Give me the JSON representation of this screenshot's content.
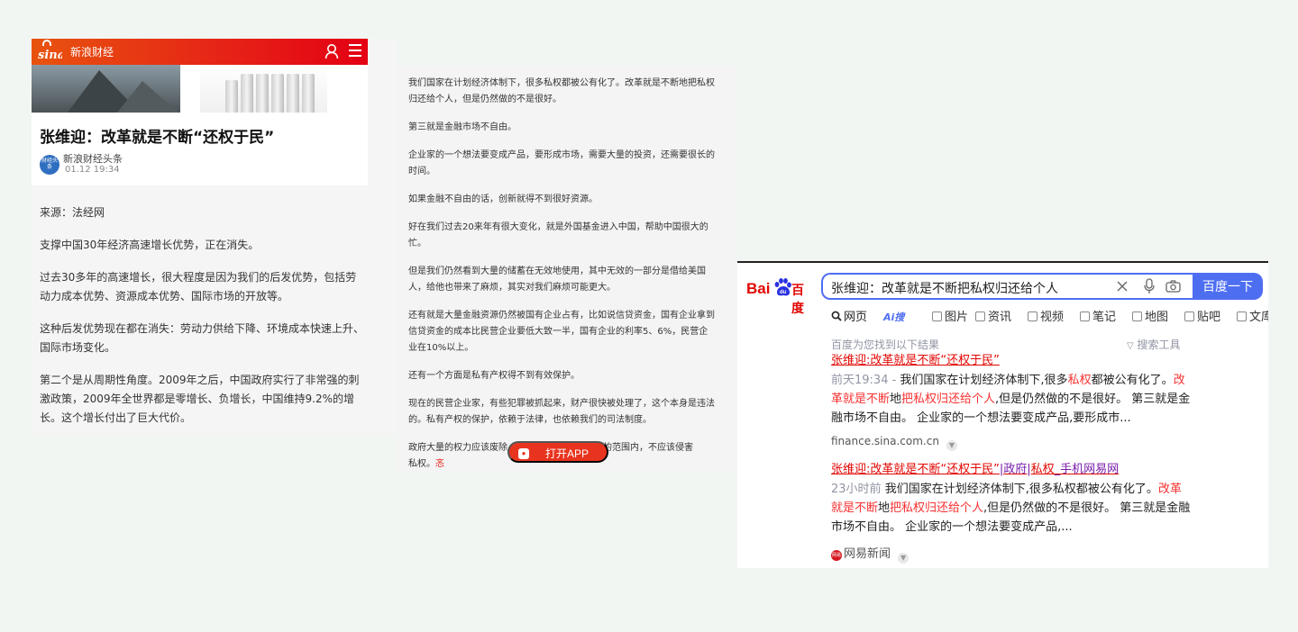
{
  "sina": {
    "channel": "新浪财经",
    "title": "张维迎：改革就是不断“还权于民”",
    "author": "新浪财经头条",
    "date": "01.12 19:34",
    "avatar_text": "财经头条",
    "paragraphs": [
      "来源：法经网",
      "支撑中国30年经济高速增长优势，正在消失。",
      "过去30多年的高速增长，很大程度是因为我们的后发优势，包括劳动力成本优势、资源成本优势、国际市场的开放等。",
      "这种后发优势现在都在消失：劳动力供给下降、环境成本快速上升、国际市场变化。",
      "第二个是从周期性角度。2009年之后，中国政府实行了非常强的刺激政策，2009年全世界都是零增长、负增长，中国维持9.2%的增长。这个增长付出了巨大代价。"
    ]
  },
  "continuation": {
    "paragraphs": [
      "我们国家在计划经济体制下，很多私权都被公有化了。改革就是不断地把私权归还给个人，但是仍然做的不是很好。",
      "第三就是金融市场不自由。",
      "企业家的一个想法要变成产品，要形成市场，需要大量的投资，还需要很长的时间。",
      "如果金融不自由的话，创新就得不到很好资源。",
      "好在我们过去20来年有很大变化，就是外国基金进入中国，帮助中国很大的忙。",
      "但是我们仍然看到大量的储蓄在无效地使用，其中无效的一部分是借给美国人，给他也带来了麻烦，其实对我们麻烦可能更大。",
      "还有就是大量金融资源仍然被国有企业占有，比如说信贷资金，国有企业拿到信贷资金的成本比民营企业要低大致一半，国有企业的利率5、6%，民营企业在10%以上。",
      "还有一个方面是私有产权得不到有效保护。",
      "现在的民营企业家，有些犯罪被抓起来，财产很快被处理了，这个本身是违法的。私有产权的保护，依赖于法律，也依赖我们的司法制度。"
    ],
    "last_paragraph_start": "政府大量的权力应该废除",
    "last_paragraph_end": "权的范围内，不应该侵害",
    "last_paragraph_tail": "私权。",
    "last_paragraph_red": "忞",
    "open_app_label": "打开APP"
  },
  "baidu": {
    "logo_latin": "Bai",
    "logo_cn": "百度",
    "query": "张维迎：改革就是不断把私权归还给个人",
    "submit_label": "百度一下",
    "tabs": [
      "网页",
      "Ai搜",
      "图片",
      "资讯",
      "视频",
      "笔记",
      "地图",
      "贴吧",
      "文库"
    ],
    "found_text": "百度为您找到以下结果",
    "tools_label": "搜索工具",
    "results": [
      {
        "title": "张维迎:改革就是不断“还权于民”",
        "time": "前天19:34 - ",
        "desc_a": "我们国家在计划经济体制下,很多",
        "desc_em1": "私权",
        "desc_b": "都被公有化了。",
        "desc_em2": "改革就是不断",
        "desc_c": "地",
        "desc_em3": "把私权归还给个人",
        "desc_d": ",但是仍然做的不是很好。 第三就是金融市场不自由。 企业家的一个想法要变成产品,要形成市...",
        "source": "finance.sina.com.cn"
      },
      {
        "title_a": "张维迎:改革就是不断“还权于民”",
        "title_sep1": "|政府|",
        "title_b": "私权",
        "title_c": "_手机网易网",
        "time": "23小时前 ",
        "desc_a": "我们国家在计划经济体制下,很多私权都被公有化了。",
        "desc_em1": "改革就是不断",
        "desc_b": "地",
        "desc_em2": "把私权归还给个人",
        "desc_c": ",但是仍然做的不是很好。 第三就是金融市场不自由。 企业家的一个想法要变成产品,...",
        "source": "网易新闻",
        "source_badge": "网易"
      }
    ]
  },
  "colors": {
    "sina_red": "#e62117",
    "baidu_blue": "#4e6ef2",
    "baidu_red": "#e10602",
    "highlight_red": "#f73131"
  }
}
